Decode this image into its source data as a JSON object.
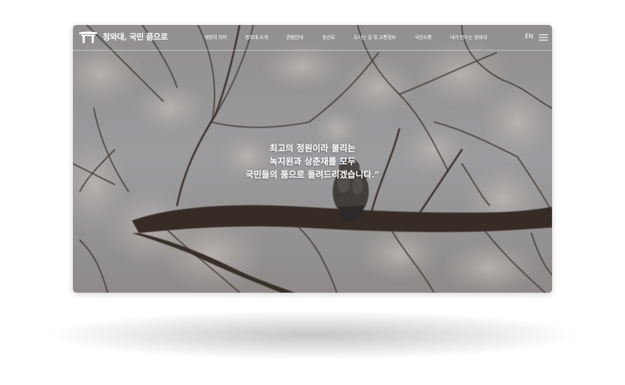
{
  "site": {
    "logo_text": "청와대, 국민 품으로"
  },
  "nav": {
    "items": [
      "개방의 의미",
      "청와대 소개",
      "관람안내",
      "등산로",
      "오시는 길 및 교통정보",
      "국민소통",
      "내가 만드는 청와대"
    ]
  },
  "language": "EN",
  "hero": {
    "quote_lines": [
      "최고의 정원이라 불리는",
      "녹지원과 상춘재를 모두",
      "국민들의 품으로 돌려드리겠습니다.”"
    ]
  },
  "colors": {
    "overlay_text": "#ffffff",
    "sky": "#c7c9cd",
    "branch": "#3a2e27",
    "blossom": "#e6dedb"
  },
  "icons": {
    "logo": "blue-house-gate-icon",
    "menu": "hamburger-menu-icon"
  }
}
